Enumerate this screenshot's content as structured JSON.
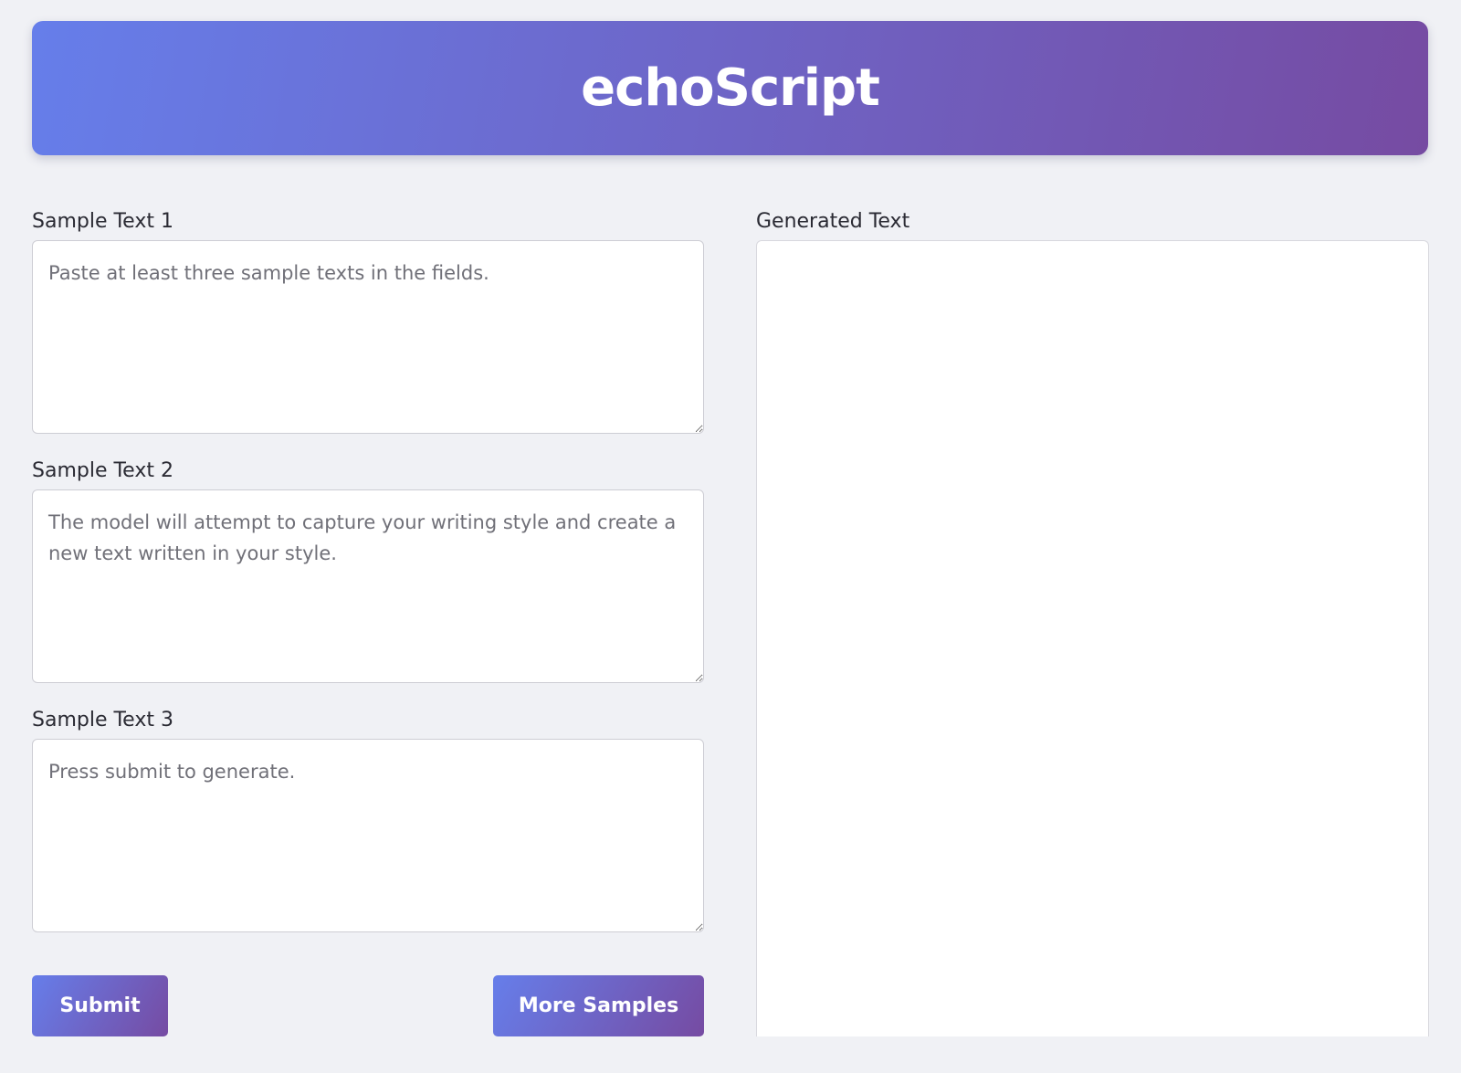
{
  "header": {
    "title": "echoScript"
  },
  "samples": [
    {
      "label": "Sample Text 1",
      "value": "",
      "placeholder": "Paste at least three sample texts in the fields."
    },
    {
      "label": "Sample Text 2",
      "value": "",
      "placeholder": "The model will attempt to capture your writing style and create a new text written in your style."
    },
    {
      "label": "Sample Text 3",
      "value": "",
      "placeholder": "Press submit to generate."
    }
  ],
  "output": {
    "label": "Generated Text",
    "value": ""
  },
  "buttons": {
    "submit_label": "Submit",
    "more_samples_label": "More Samples"
  },
  "colors": {
    "gradient_start": "#667eea",
    "gradient_end": "#764ba2",
    "background": "#f0f1f5"
  }
}
